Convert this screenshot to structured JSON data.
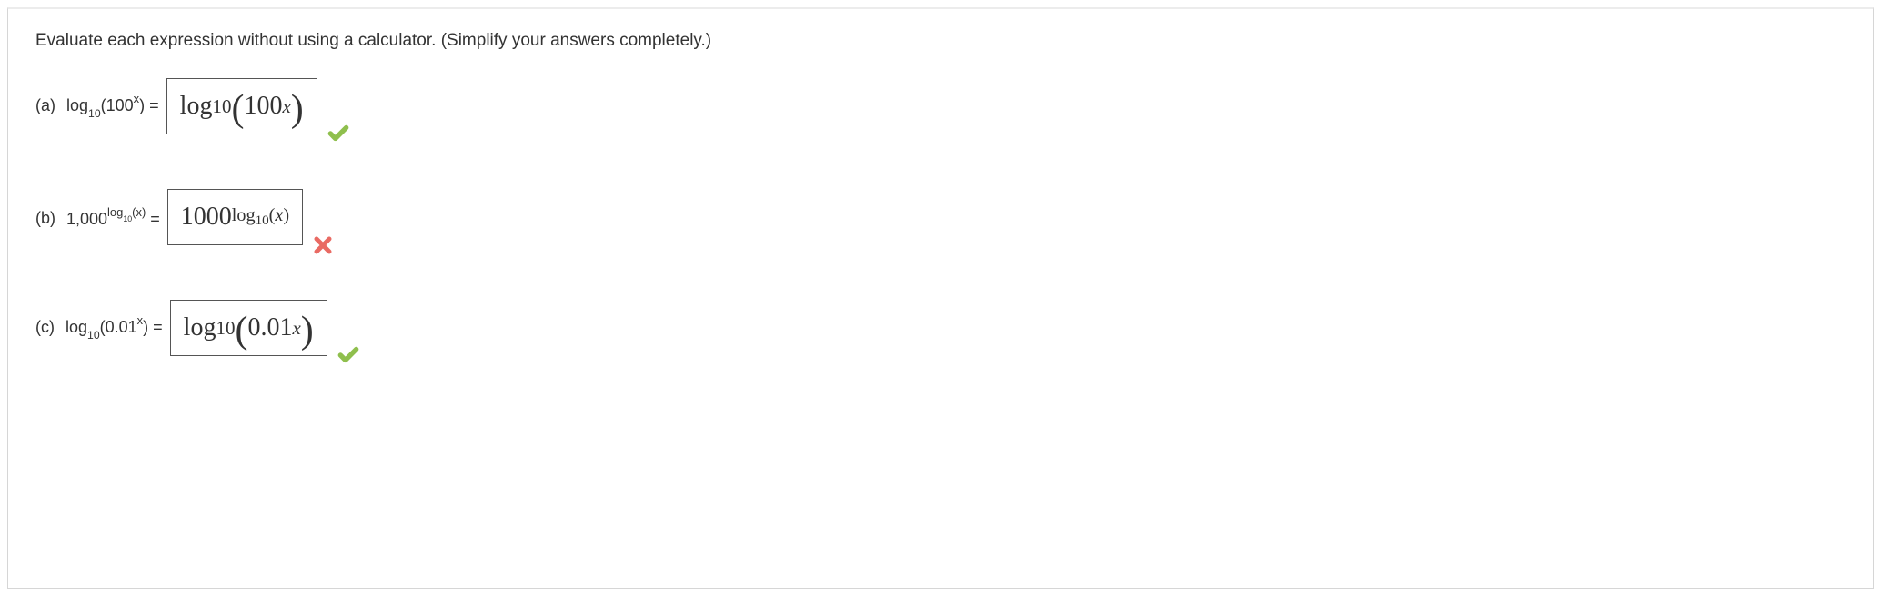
{
  "instruction": "Evaluate each expression without using a calculator. (Simplify your answers completely.)",
  "parts": {
    "a": {
      "letter": "(a)",
      "expr": {
        "pre": "log",
        "sub": "10",
        "open": "(100",
        "sup": "x",
        "close": ") ="
      },
      "answer": {
        "log": "log",
        "logsub": "10",
        "base": "100",
        "exp": "x"
      },
      "status": "correct"
    },
    "b": {
      "letter": "(b)",
      "expr": {
        "pre": "1,000",
        "sup_pre": "log",
        "sup_sub": "10",
        "sup_open": "(",
        "sup_var": "x",
        "sup_close": ")",
        "eq": " ="
      },
      "answer": {
        "base": "1000",
        "log": "log",
        "logsub": "10",
        "open": "(",
        "var": "x",
        "close": ")"
      },
      "status": "incorrect"
    },
    "c": {
      "letter": "(c)",
      "expr": {
        "pre": "log",
        "sub": "10",
        "open": "(0.01",
        "sup": "x",
        "close": ") ="
      },
      "answer": {
        "log": "log",
        "logsub": "10",
        "base": "0.01",
        "exp": "x"
      },
      "status": "correct"
    }
  }
}
